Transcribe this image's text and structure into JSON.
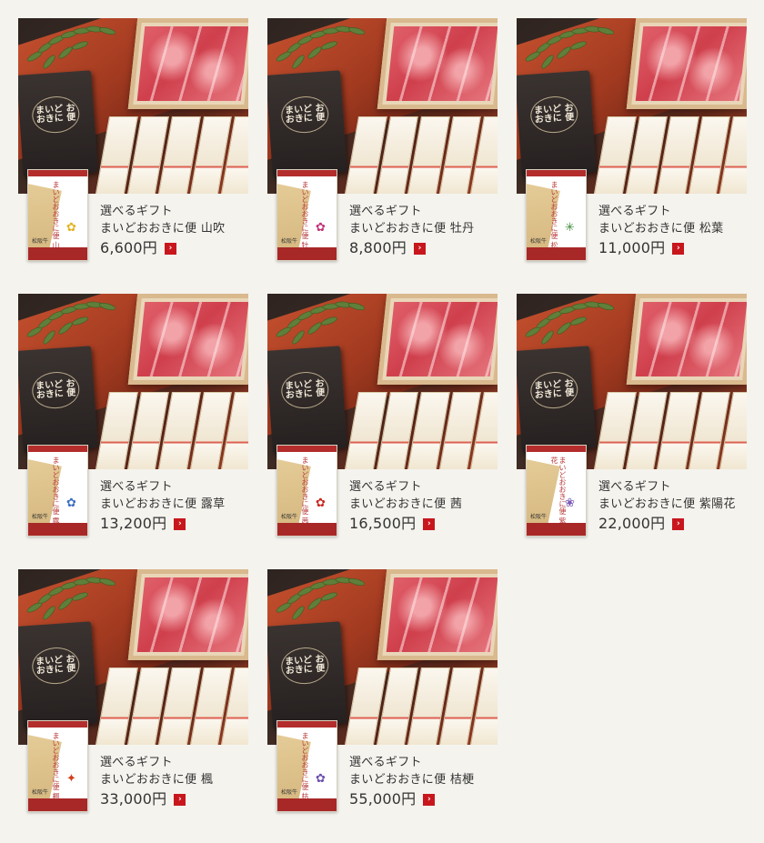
{
  "products": [
    {
      "line1": "選べるギフト",
      "line2": "まいどおおきに便 山吹",
      "price": "6,600円",
      "flower_icon": "yellow-flower-icon",
      "flower_glyph": "✿",
      "flower_color": "#e3b21f",
      "thumb_text": "まいどおおきに便 山吹"
    },
    {
      "line1": "選べるギフト",
      "line2": "まいどおおきに便 牡丹",
      "price": "8,800円",
      "flower_icon": "peony-icon",
      "flower_glyph": "✿",
      "flower_color": "#c2327a",
      "thumb_text": "まいどおおきに便 牡丹"
    },
    {
      "line1": "選べるギフト",
      "line2": "まいどおおきに便 松葉",
      "price": "11,000円",
      "flower_icon": "pine-icon",
      "flower_glyph": "✳",
      "flower_color": "#3f8a3a",
      "thumb_text": "まいどおおきに便 松葉"
    },
    {
      "line1": "選べるギフト",
      "line2": "まいどおおきに便 露草",
      "price": "13,200円",
      "flower_icon": "dayflower-icon",
      "flower_glyph": "✿",
      "flower_color": "#3b6fc4",
      "thumb_text": "まいどおおきに便 露草"
    },
    {
      "line1": "選べるギフト",
      "line2": "まいどおおきに便 茜",
      "price": "16,500円",
      "flower_icon": "madder-icon",
      "flower_glyph": "✿",
      "flower_color": "#c8271f",
      "thumb_text": "まいどおおきに便 茜"
    },
    {
      "line1": "選べるギフト",
      "line2": "まいどおおきに便 紫陽花",
      "price": "22,000円",
      "flower_icon": "hydrangea-icon",
      "flower_glyph": "❀",
      "flower_color": "#7a5bb5",
      "thumb_text": "まいどおおきに便 紫陽花"
    },
    {
      "line1": "選べるギフト",
      "line2": "まいどおおきに便 楓",
      "price": "33,000円",
      "flower_icon": "maple-leaf-icon",
      "flower_glyph": "✦",
      "flower_color": "#d2401f",
      "thumb_text": "まいどおおきに便 楓"
    },
    {
      "line1": "選べるギフト",
      "line2": "まいどおおきに便 桔梗",
      "price": "55,000円",
      "flower_icon": "bellflower-icon",
      "flower_glyph": "✿",
      "flower_color": "#6a4fb0",
      "thumb_text": "まいどおおきに便 桔梗"
    }
  ],
  "folder_logo": "まいど おおきに 便",
  "thumb_brand": "松阪牛",
  "arrow_glyph": "›",
  "accent_color": "#c8161d"
}
